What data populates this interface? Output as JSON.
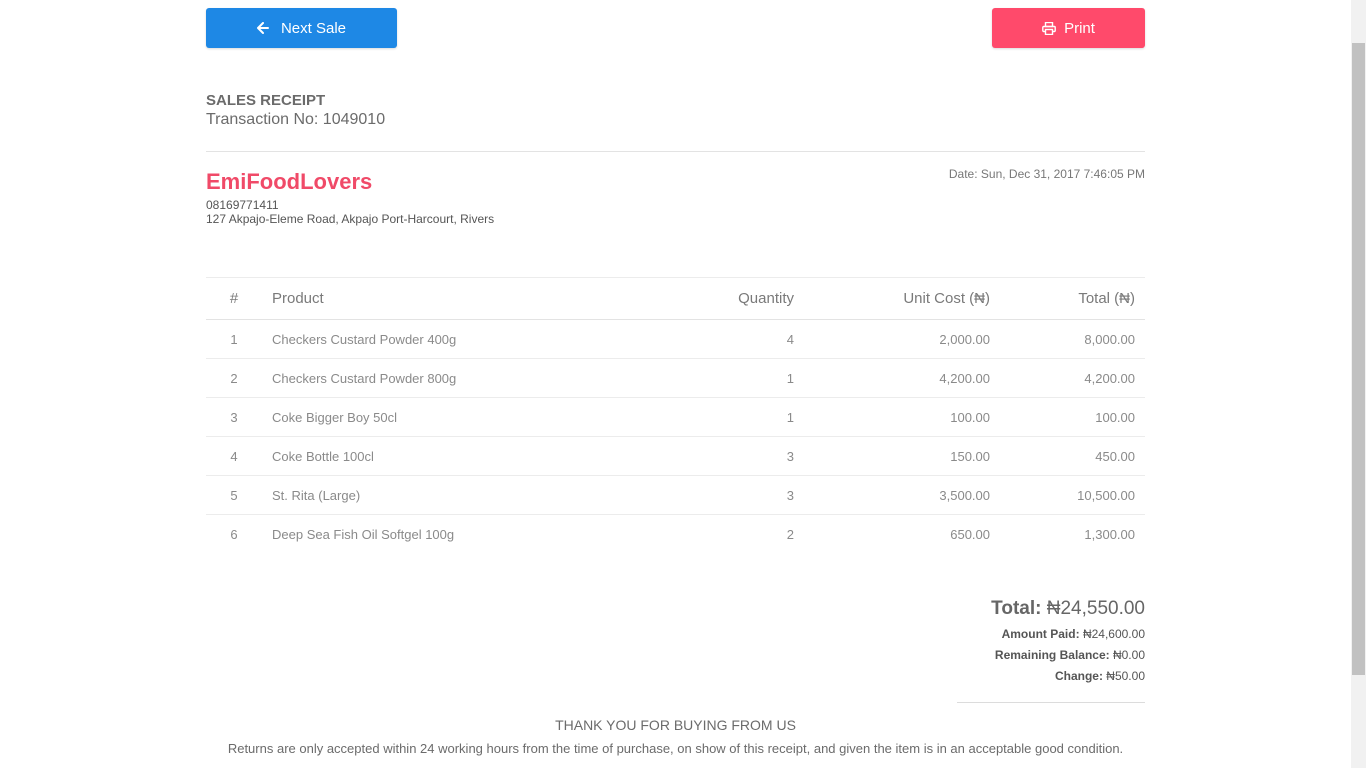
{
  "actions": {
    "next_sale_label": "Next Sale",
    "print_label": "Print"
  },
  "receipt": {
    "title": "SALES RECEIPT",
    "transaction_label": "Transaction No:",
    "transaction_no": "1049010"
  },
  "business": {
    "name": "EmiFoodLovers",
    "phone": "08169771411",
    "address": "127 Akpajo-Eleme Road, Akpajo Port-Harcourt, Rivers",
    "date": "Date: Sun, Dec 31, 2017 7:46:05 PM"
  },
  "table": {
    "headers": [
      "#",
      "Product",
      "Quantity",
      "Unit Cost (₦)",
      "Total (₦)"
    ],
    "rows": [
      [
        "1",
        "Checkers Custard Powder 400g",
        "4",
        "2,000.00",
        "8,000.00"
      ],
      [
        "2",
        "Checkers Custard Powder 800g",
        "1",
        "4,200.00",
        "4,200.00"
      ],
      [
        "3",
        "Coke Bigger Boy 50cl",
        "1",
        "100.00",
        "100.00"
      ],
      [
        "4",
        "Coke Bottle 100cl",
        "3",
        "150.00",
        "450.00"
      ],
      [
        "5",
        "St. Rita (Large)",
        "3",
        "3,500.00",
        "10,500.00"
      ],
      [
        "6",
        "Deep Sea Fish Oil Softgel 100g",
        "2",
        "650.00",
        "1,300.00"
      ]
    ]
  },
  "totals": {
    "total_label": "Total:",
    "total_value": "₦24,550.00",
    "amount_paid_label": "Amount Paid:",
    "amount_paid_value": "₦24,600.00",
    "remaining_label": "Remaining Balance:",
    "remaining_value": "₦0.00",
    "change_label": "Change:",
    "change_value": "₦50.00"
  },
  "footer": {
    "thanks": "THANK YOU FOR BUYING FROM US",
    "policy": "Returns are only accepted within 24 working hours from the time of purchase, on show of this receipt, and given the item is in an acceptable good condition."
  },
  "colors": {
    "primary": "#1e88e5",
    "danger": "#ff4a6b",
    "brand": "#f04a68"
  },
  "icons": {
    "next": "arrow-left-icon",
    "print": "printer-icon"
  }
}
